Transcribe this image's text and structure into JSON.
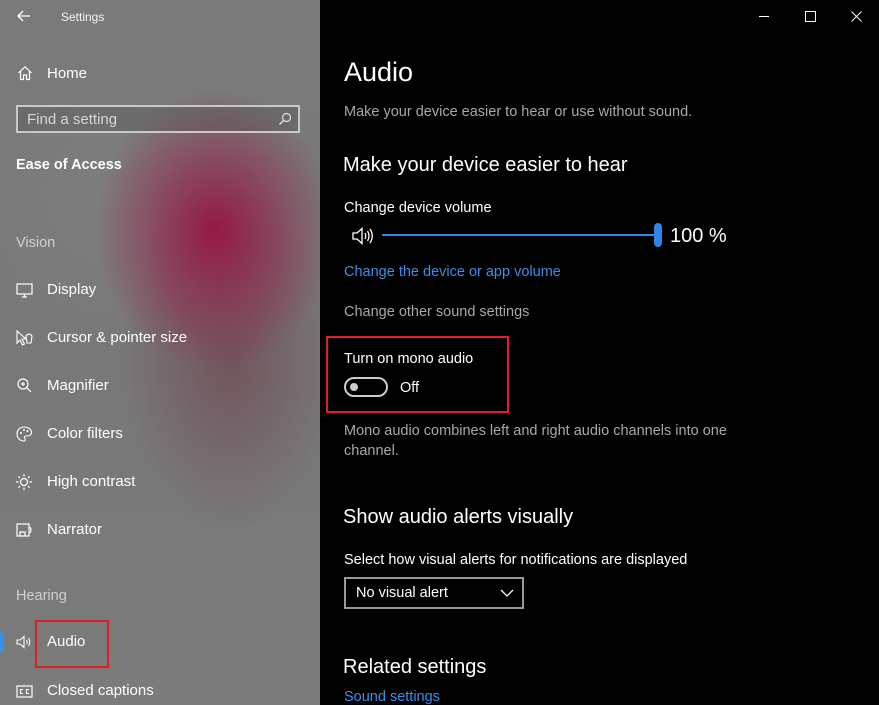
{
  "window": {
    "title": "Settings",
    "controls": {
      "minimize": "minimize-icon",
      "maximize": "maximize-icon",
      "close": "close-icon"
    }
  },
  "sidebar": {
    "back_icon": "back-arrow-icon",
    "home": {
      "label": "Home",
      "icon": "home-icon"
    },
    "search": {
      "placeholder": "Find a setting",
      "value": "",
      "icon": "search-icon"
    },
    "category": "Ease of Access",
    "groups": [
      {
        "header": "Vision",
        "items": [
          {
            "label": "Display",
            "icon": "display-icon"
          },
          {
            "label": "Cursor & pointer size",
            "icon": "cursor-icon"
          },
          {
            "label": "Magnifier",
            "icon": "magnifier-icon"
          },
          {
            "label": "Color filters",
            "icon": "color-filters-icon"
          },
          {
            "label": "High contrast",
            "icon": "high-contrast-icon"
          },
          {
            "label": "Narrator",
            "icon": "narrator-icon"
          }
        ]
      },
      {
        "header": "Hearing",
        "items": [
          {
            "label": "Audio",
            "icon": "speaker-icon",
            "selected": true
          },
          {
            "label": "Closed captions",
            "icon": "closed-captions-icon"
          }
        ]
      }
    ]
  },
  "main": {
    "title": "Audio",
    "subtitle": "Make your device easier to hear or use without sound.",
    "section_hear": {
      "heading": "Make your device easier to hear",
      "volume_label": "Change device volume",
      "volume_value": 100,
      "volume_text": "100 %",
      "app_volume_link": "Change the device or app volume",
      "other_sound": "Change other sound settings",
      "mono_label": "Turn on mono audio",
      "mono_on": false,
      "mono_state": "Off",
      "mono_desc": "Mono audio combines left and right audio channels into one channel."
    },
    "section_alerts": {
      "heading": "Show audio alerts visually",
      "select_label": "Select how visual alerts for notifications are displayed",
      "select_value": "No visual alert"
    },
    "related": {
      "heading": "Related settings",
      "sound_settings_link": "Sound settings"
    }
  },
  "colors": {
    "accent": "#2f86e6",
    "link": "#3b8fe8",
    "highlight_box": "#e02020"
  }
}
